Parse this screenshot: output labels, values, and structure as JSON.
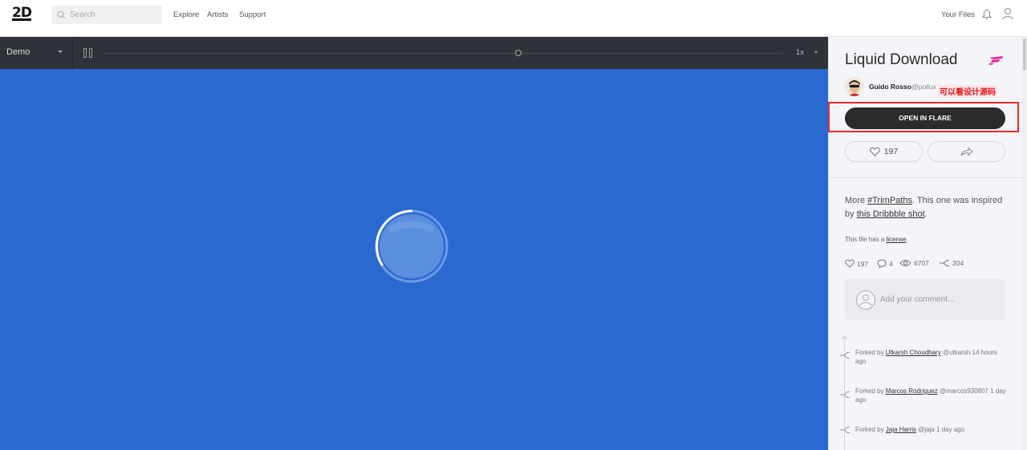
{
  "topbar": {
    "logo": "2D",
    "search_placeholder": "Search",
    "nav": [
      "Explore",
      "Artists",
      "Support"
    ],
    "your_files": "Your Files"
  },
  "player": {
    "mode": "Demo",
    "speed": "1x"
  },
  "colors": {
    "stage_bg": "#2a69d0",
    "player_bar": "#2f3238",
    "accent_pink": "#e6249a",
    "annotation_red": "#e82a2a"
  },
  "file": {
    "title": "Liquid Download",
    "author_name": "Guido Rosso",
    "author_handle": "@pollux",
    "annotation": "可以看设计源码",
    "open_button": "OPEN IN FLARE",
    "like_count": "197",
    "description": {
      "prefix": "More ",
      "tag": "#TrimPaths",
      "middle": ". This one was inspired by ",
      "link": "this Dribbble shot",
      "suffix": "."
    },
    "license_prefix": "This file has a ",
    "license_link": "license",
    "license_suffix": ".",
    "stats": {
      "likes": "197",
      "comments": "4",
      "views": "6707",
      "forks": "204"
    },
    "comment_placeholder": "Add your comment..."
  },
  "forks": [
    {
      "prefix": "Forked by ",
      "name": "Utkarsh Choudhary",
      "rest": " @utkarsh 14 hours ago"
    },
    {
      "prefix": "Forked by ",
      "name": "Marcos Rodriguez",
      "rest": " @marcos930807 1 day ago"
    },
    {
      "prefix": "Forked by ",
      "name": "Jaja Harris",
      "rest": " @jaja 1 day ago"
    }
  ]
}
